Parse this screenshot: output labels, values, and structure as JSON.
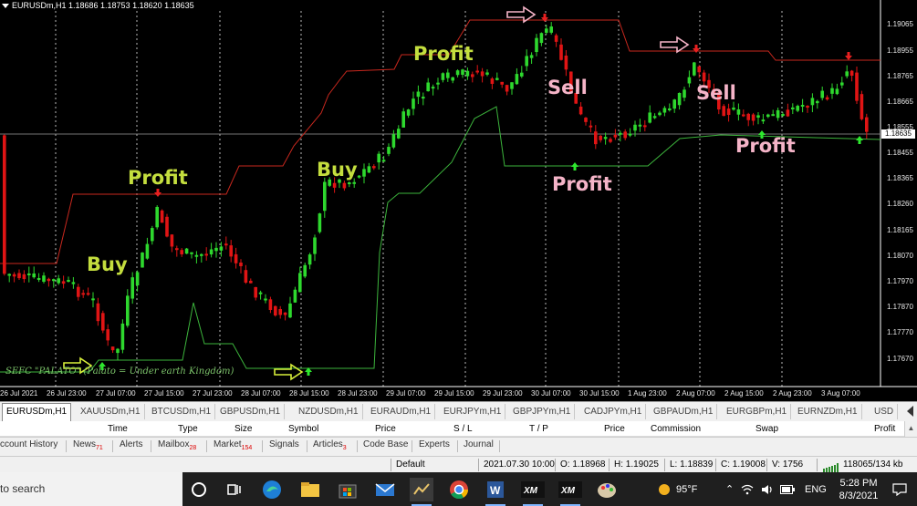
{
  "window": {
    "symbol_header": "EURUSDm,H1  1.18686 1.18753 1.18620 1.18635"
  },
  "annotations": {
    "buy1": "Buy",
    "profit1": "Profit",
    "buy2": "Buy",
    "profit2": "Profit",
    "sell1": "Sell",
    "profit3": "Profit",
    "sell2": "Sell",
    "profit4": "Profit"
  },
  "watermark": "SEFC \"PALATO\" (Palato = Under earth Kingdom)",
  "price_axis": {
    "ticks": [
      "1.19065",
      "1.18955",
      "1.18765",
      "1.18665",
      "1.18555",
      "1.18455",
      "1.18365",
      "1.18260",
      "1.18165",
      "1.18070",
      "1.17970",
      "1.17870",
      "1.17770",
      "1.17670"
    ],
    "current": "1.18635"
  },
  "time_axis": {
    "ticks": [
      "26 Jul 2021",
      "26 Jul 23:00",
      "27 Jul 07:00",
      "27 Jul 15:00",
      "27 Jul 23:00",
      "28 Jul 07:00",
      "28 Jul 15:00",
      "28 Jul 23:00",
      "29 Jul 07:00",
      "29 Jul 15:00",
      "29 Jul 23:00",
      "30 Jul 07:00",
      "30 Jul 15:00",
      "1 Aug 23:00",
      "2 Aug 07:00",
      "2 Aug 15:00",
      "2 Aug 23:00",
      "3 Aug 07:00"
    ]
  },
  "chart_tabs": [
    "EURUSDm,H1",
    "XAUUSDm,H1",
    "BTCUSDm,H1",
    "GBPUSDm,H1",
    "NZDUSDm,H1",
    "EURAUDm,H1",
    "EURJPYm,H1",
    "GBPJPYm,H1",
    "CADJPYm,H1",
    "GBPAUDm,H1",
    "EURGBPm,H1",
    "EURNZDm,H1",
    "USD"
  ],
  "terminal_columns": [
    "Time",
    "Type",
    "Size",
    "Symbol",
    "Price",
    "S / L",
    "T / P",
    "Price",
    "Commission",
    "Swap",
    "Profit"
  ],
  "terminal_tabs": {
    "account_history": "ccount History",
    "news": "News",
    "news_count": "71",
    "alerts": "Alerts",
    "mailbox": "Mailbox",
    "mailbox_count": "28",
    "market": "Market",
    "market_count": "154",
    "signals": "Signals",
    "articles": "Articles",
    "articles_count": "3",
    "code_base": "Code Base",
    "experts": "Experts",
    "journal": "Journal"
  },
  "status_bar": {
    "profile": "Default",
    "datetime": "2021.07.30 10:00",
    "open": "O: 1.18968",
    "high": "H: 1.19025",
    "low": "L: 1.18839",
    "close": "C: 1.19008",
    "volume": "V: 1756",
    "traffic": "118065/134 kb"
  },
  "taskbar": {
    "search_text": "to search",
    "weather": "95°F",
    "language": "ENG",
    "time": "5:28 PM",
    "date": "8/3/2021"
  },
  "colors": {
    "bull": "#2ed82e",
    "bear": "#e01414",
    "upper_channel": "#c8281e",
    "lower_channel": "#3cb43c",
    "annotation_green": "#c4de3e",
    "annotation_pink": "#f5b4c8"
  }
}
